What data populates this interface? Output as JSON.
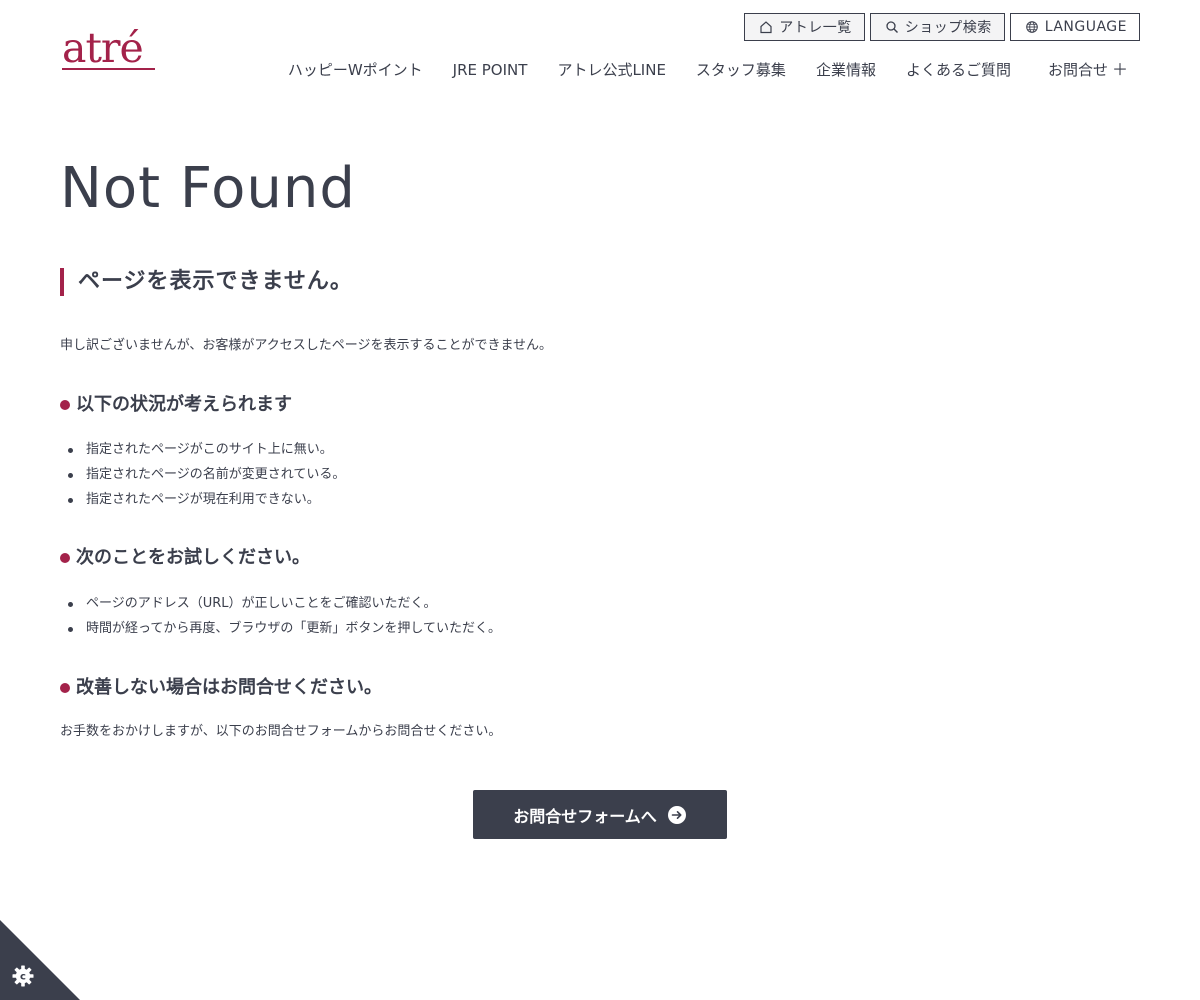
{
  "header": {
    "logo_text": "atré",
    "utility": [
      {
        "label": "アトレ一覧",
        "icon": "home-icon"
      },
      {
        "label": "ショップ検索",
        "icon": "search-icon"
      },
      {
        "label": "LANGUAGE",
        "icon": "globe-icon"
      }
    ],
    "nav": [
      {
        "label": "ハッピーWポイント"
      },
      {
        "label": "JRE POINT"
      },
      {
        "label": "アトレ公式LINE"
      },
      {
        "label": "スタッフ募集"
      },
      {
        "label": "企業情報"
      },
      {
        "label": "よくあるご質問"
      },
      {
        "label": "お問合せ",
        "suffix": "＋"
      }
    ]
  },
  "main": {
    "title": "Not Found",
    "heading": "ページを表示できません。",
    "intro": "申し訳ございませんが、お客様がアクセスしたページを表示することができません。",
    "sections": [
      {
        "heading": "以下の状況が考えられます",
        "items": [
          "指定されたページがこのサイト上に無い。",
          "指定されたページの名前が変更されている。",
          "指定されたページが現在利用できない。"
        ]
      },
      {
        "heading": "次のことをお試しください。",
        "items": [
          "ページのアドレス（URL）が正しいことをご確認いただく。",
          "時間が経ってから再度、ブラウザの「更新」ボタンを押していただく。"
        ]
      },
      {
        "heading": "改善しない場合はお問合せください。",
        "items": []
      }
    ],
    "closing": "お手数をおかけしますが、以下のお問合せフォームからお問合せください。",
    "cta_label": "お問合せフォームへ"
  },
  "colors": {
    "brand": "#a3224a",
    "text": "#3b3f4c",
    "button_bg": "#3b3f4c"
  },
  "cookie": {
    "icon": "gear-icon"
  }
}
